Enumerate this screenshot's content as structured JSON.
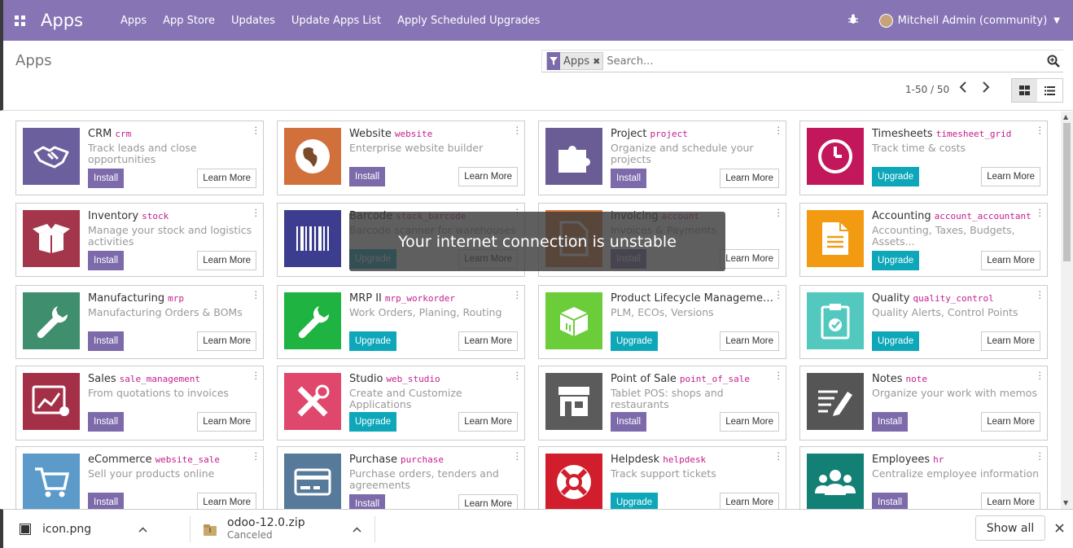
{
  "nav": {
    "brand": "Apps",
    "menu": [
      "Apps",
      "App Store",
      "Updates",
      "Update Apps List",
      "Apply Scheduled Upgrades"
    ],
    "user": "Mitchell Admin (community)"
  },
  "control": {
    "title": "Apps",
    "facet": "Apps",
    "search_placeholder": "Search...",
    "pager": "1-50 / 50"
  },
  "toast": "Your internet connection is unstable",
  "cards": [
    {
      "name": "CRM",
      "tech": "crm",
      "desc": "Track leads and close opportunities",
      "btn": "Install",
      "type": "install",
      "color": "#6b5f9e",
      "icon": "handshake-icon"
    },
    {
      "name": "Website",
      "tech": "website",
      "desc": "Enterprise website builder",
      "btn": "Install",
      "type": "install",
      "color": "#d2703c",
      "icon": "globe-icon"
    },
    {
      "name": "Project",
      "tech": "project",
      "desc": "Organize and schedule your projects",
      "btn": "Install",
      "type": "install",
      "color": "#6a5d96",
      "icon": "puzzle-icon"
    },
    {
      "name": "Timesheets",
      "tech": "timesheet_grid",
      "desc": "Track time & costs",
      "btn": "Upgrade",
      "type": "upgrade",
      "color": "#c2185b",
      "icon": "clock-icon"
    },
    {
      "name": "Inventory",
      "tech": "stock",
      "desc": "Manage your stock and logistics activities",
      "btn": "Install",
      "type": "install",
      "color": "#a3364a",
      "icon": "box-icon"
    },
    {
      "name": "Barcode",
      "tech": "stock_barcode",
      "desc": "Barcode scanner for warehouses",
      "btn": "Upgrade",
      "type": "upgrade",
      "color": "#3d3d8f",
      "icon": "barcode-icon"
    },
    {
      "name": "Invoicing",
      "tech": "account",
      "desc": "Invoices & Payments",
      "btn": "Install",
      "type": "install",
      "color": "#d6763a",
      "icon": "invoice-icon"
    },
    {
      "name": "Accounting",
      "tech": "account_accountant",
      "desc": "Accounting, Taxes, Budgets, Assets...",
      "btn": "Upgrade",
      "type": "upgrade",
      "color": "#f29b12",
      "icon": "document-icon"
    },
    {
      "name": "Manufacturing",
      "tech": "mrp",
      "desc": "Manufacturing Orders & BOMs",
      "btn": "Install",
      "type": "install",
      "color": "#3f8f6e",
      "icon": "wrench-icon"
    },
    {
      "name": "MRP II",
      "tech": "mrp_workorder",
      "desc": "Work Orders, Planing, Routing",
      "btn": "Upgrade",
      "type": "upgrade",
      "color": "#1fb341",
      "icon": "wrench-icon"
    },
    {
      "name": "Product Lifecycle Management",
      "tech": "mrp_plm",
      "desc": "PLM, ECOs, Versions",
      "btn": "Upgrade",
      "type": "upgrade",
      "color": "#6ccd3b",
      "icon": "cube-icon"
    },
    {
      "name": "Quality",
      "tech": "quality_control",
      "desc": "Quality Alerts, Control Points",
      "btn": "Upgrade",
      "type": "upgrade",
      "color": "#52c8be",
      "icon": "clipboard-icon"
    },
    {
      "name": "Sales",
      "tech": "sale_management",
      "desc": "From quotations to invoices",
      "btn": "Install",
      "type": "install",
      "color": "#a33046",
      "icon": "chart-icon"
    },
    {
      "name": "Studio",
      "tech": "web_studio",
      "desc": "Create and Customize Applications",
      "btn": "Upgrade",
      "type": "upgrade",
      "color": "#e0476d",
      "icon": "tools-icon"
    },
    {
      "name": "Point of Sale",
      "tech": "point_of_sale",
      "desc": "Tablet POS: shops and restaurants",
      "btn": "Install",
      "type": "install",
      "color": "#5b5b5b",
      "icon": "store-icon"
    },
    {
      "name": "Notes",
      "tech": "note",
      "desc": "Organize your work with memos",
      "btn": "Install",
      "type": "install",
      "color": "#555555",
      "icon": "note-icon"
    },
    {
      "name": "eCommerce",
      "tech": "website_sale",
      "desc": "Sell your products online",
      "btn": "Install",
      "type": "install",
      "color": "#5b9ac9",
      "icon": "cart-icon"
    },
    {
      "name": "Purchase",
      "tech": "purchase",
      "desc": "Purchase orders, tenders and agreements",
      "btn": "Install",
      "type": "install",
      "color": "#587a9a",
      "icon": "card-icon"
    },
    {
      "name": "Helpdesk",
      "tech": "helpdesk",
      "desc": "Track support tickets",
      "btn": "Upgrade",
      "type": "upgrade",
      "color": "#d11d2c",
      "icon": "lifebuoy-icon"
    },
    {
      "name": "Employees",
      "tech": "hr",
      "desc": "Centralize employee information",
      "btn": "Install",
      "type": "install",
      "color": "#138076",
      "icon": "people-icon"
    }
  ],
  "learn_label": "Learn More",
  "downloads": {
    "items": [
      {
        "name": "icon.png",
        "status": ""
      },
      {
        "name": "odoo-12.0.zip",
        "status": "Canceled"
      }
    ],
    "show_all": "Show all"
  }
}
